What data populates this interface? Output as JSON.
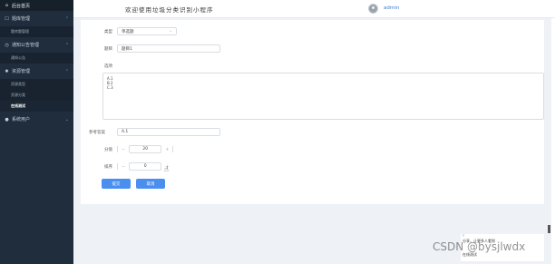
{
  "sidebar": {
    "home": "后台首页",
    "groups": [
      {
        "label": "题库管理",
        "items": [
          "题库题管理"
        ]
      },
      {
        "label": "通知公告管理",
        "items": [
          "通知公告"
        ]
      },
      {
        "label": "资源管理",
        "items": [
          "资源类型",
          "资源分类",
          "在线测试"
        ]
      },
      {
        "label": "系统用户",
        "items": []
      }
    ],
    "active_item": "在线测试"
  },
  "header": {
    "title": "欢迎使用垃圾分类识别小程序",
    "user": "admin"
  },
  "form": {
    "type_label": "类型",
    "type_value": "单选题",
    "question_label": "题目",
    "question_value": "题目1",
    "options_label": "选项",
    "options_lines": [
      "A.1",
      "B.2",
      "C.3"
    ],
    "answer_label": "参考答案",
    "answer_value": "A.1",
    "score_label": "分值",
    "score_value": "20",
    "order_label": "排序",
    "order_value": "0",
    "submit_label": "提交",
    "cancel_label": "取消"
  },
  "watermark": {
    "text": "CSDN @bysjlwdx",
    "panel_line1": "分享，让更多人看到",
    "panel_line2": "在线测试"
  },
  "colors": {
    "sidebar_bg": "#1f2d3d",
    "primary": "#4a8ff0",
    "content_bg": "#eef1f5"
  }
}
